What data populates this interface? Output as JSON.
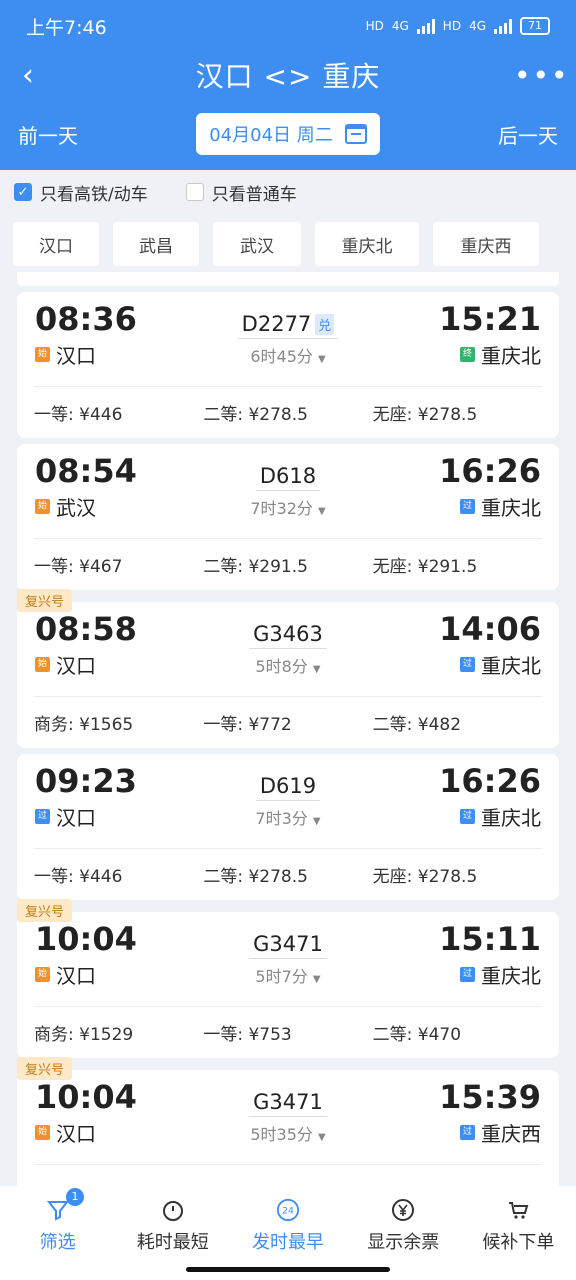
{
  "status": {
    "time": "上午7:46",
    "net1": "HD",
    "net2": "4G",
    "net3": "HD",
    "net4": "4G",
    "battery": "71"
  },
  "header": {
    "title": "汉口 <> 重庆",
    "prev_day": "前一天",
    "next_day": "后一天",
    "date": "04月04日 周二"
  },
  "filters": {
    "high_speed": "只看高铁/动车",
    "normal": "只看普通车"
  },
  "stations": [
    "汉口",
    "武昌",
    "武汉",
    "重庆北",
    "重庆西"
  ],
  "trains": [
    {
      "dep_time": "08:36",
      "dep_tag": "始",
      "dep_station": "汉口",
      "no": "D2277",
      "extra": "兑",
      "duration": "6时45分",
      "arr_time": "15:21",
      "arr_tag": "终",
      "arr_station": "重庆北",
      "seats": [
        "一等: ¥446",
        "二等: ¥278.5",
        "无座: ¥278.5"
      ]
    },
    {
      "dep_time": "08:54",
      "dep_tag": "始",
      "dep_station": "武汉",
      "no": "D618",
      "duration": "7时32分",
      "arr_time": "16:26",
      "arr_tag": "过",
      "arr_station": "重庆北",
      "seats": [
        "一等: ¥467",
        "二等: ¥291.5",
        "无座: ¥291.5"
      ]
    },
    {
      "label": "复兴号",
      "dep_time": "08:58",
      "dep_tag": "始",
      "dep_station": "汉口",
      "no": "G3463",
      "duration": "5时8分",
      "arr_time": "14:06",
      "arr_tag": "过",
      "arr_station": "重庆北",
      "seats": [
        "商务: ¥1565",
        "一等: ¥772",
        "二等: ¥482"
      ]
    },
    {
      "dep_time": "09:23",
      "dep_tag": "过",
      "dep_station": "汉口",
      "no": "D619",
      "duration": "7时3分",
      "arr_time": "16:26",
      "arr_tag": "过",
      "arr_station": "重庆北",
      "seats": [
        "一等: ¥446",
        "二等: ¥278.5",
        "无座: ¥278.5"
      ]
    },
    {
      "label": "复兴号",
      "dep_time": "10:04",
      "dep_tag": "始",
      "dep_station": "汉口",
      "no": "G3471",
      "duration": "5时7分",
      "arr_time": "15:11",
      "arr_tag": "过",
      "arr_station": "重庆北",
      "seats": [
        "商务: ¥1529",
        "一等: ¥753",
        "二等: ¥470"
      ]
    },
    {
      "label": "复兴号",
      "dep_time": "10:04",
      "dep_tag": "始",
      "dep_station": "汉口",
      "no": "G3471",
      "duration": "5时35分",
      "arr_time": "15:39",
      "arr_tag": "过",
      "arr_station": "重庆西",
      "seats": [
        "",
        "",
        ""
      ]
    }
  ],
  "tabbar": {
    "filter": "筛选",
    "filter_badge": "1",
    "shortest": "耗时最短",
    "earliest": "发时最早",
    "earliest_icon": "24",
    "remaining": "显示余票",
    "waitlist": "候补下单"
  },
  "colors": {
    "primary": "#3d8ef0",
    "start": "#f0922c",
    "end": "#33b36b"
  }
}
